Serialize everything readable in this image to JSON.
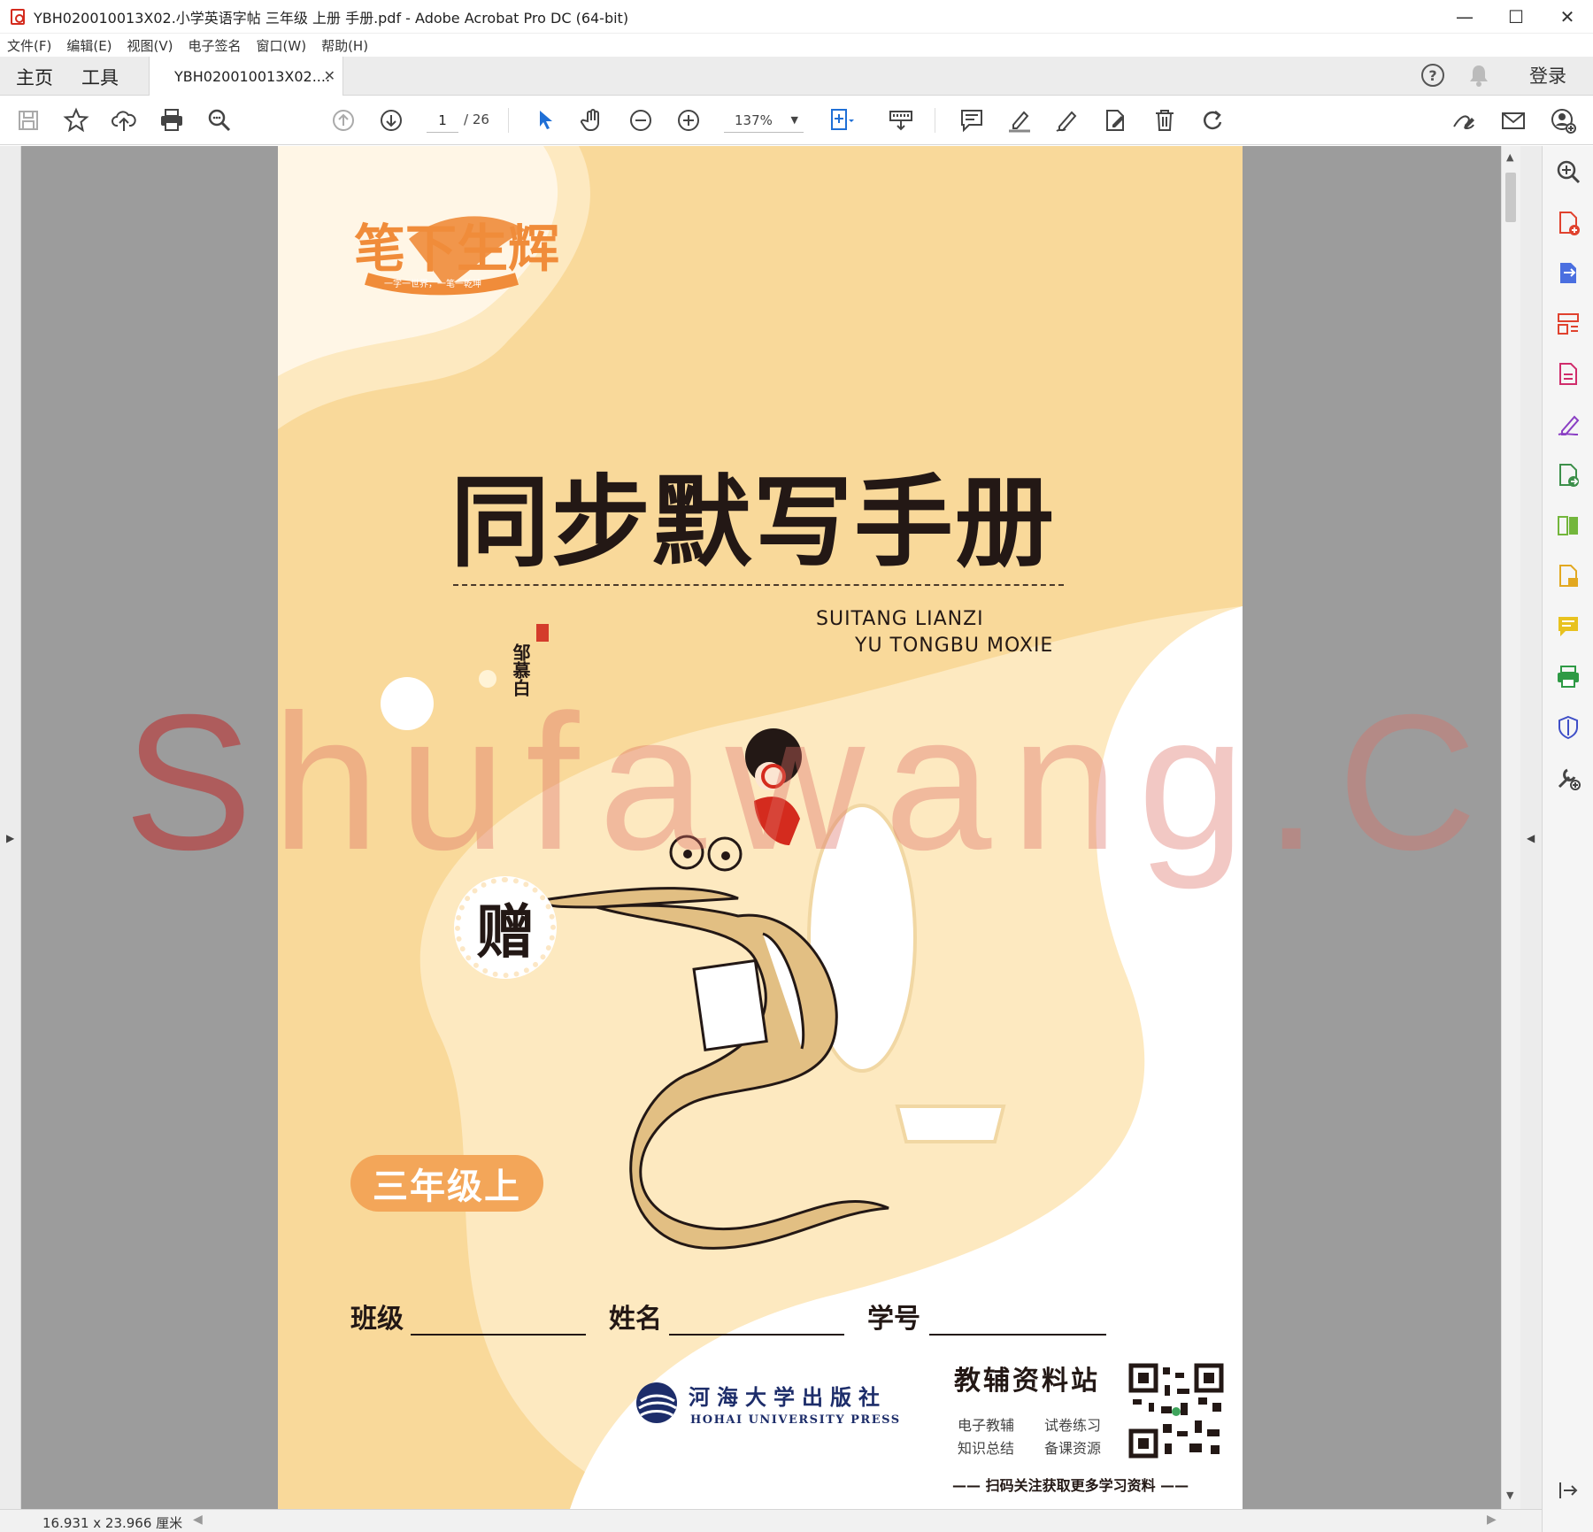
{
  "window": {
    "title": "YBH020010013X02.小学英语字帖 三年级 上册 手册.pdf - Adobe Acrobat Pro DC (64-bit)",
    "minimize": "—",
    "maximize": "☐",
    "close": "✕"
  },
  "menu": [
    "文件(F)",
    "编辑(E)",
    "视图(V)",
    "电子签名",
    "窗口(W)",
    "帮助(H)"
  ],
  "tabs": {
    "home": "主页",
    "tools": "工具",
    "document": "YBH020010013X02....",
    "document_close": "✕",
    "login": "登录"
  },
  "toolbar": {
    "current_page": "1",
    "total_pages": "/ 26",
    "zoom": "137%"
  },
  "status": {
    "page_size": "16.931 x 23.966 厘米"
  },
  "document": {
    "brand_logo": "笔下生辉",
    "brand_slogan": "一字一世界，一笔一乾坤",
    "title": "同步默写手册",
    "pinyin_line1": "SUITANG  LIANZI",
    "pinyin_line2": "YU TONGBU  MOXIE",
    "gift_char": "赠",
    "calligrapher_signature": "邹慕白",
    "grade": "三年级上",
    "fields": {
      "class": "班级",
      "name": "姓名",
      "student_id": "学号"
    },
    "publisher_cn": "河海大学出版社",
    "publisher_en": "HOHAI UNIVERSITY PRESS",
    "site_title": "教辅资料站",
    "site_tags": [
      "电子教辅",
      "试卷练习",
      "知识总结",
      "备课资源"
    ],
    "scan_text": "—— 扫码关注获取更多学习资料 ——"
  },
  "watermark": {
    "first": "S",
    "rest": "hufawang.CN"
  },
  "colors": {
    "page_bg": "#f9d99a",
    "grade_badge": "#f3a659",
    "accent_blue": "#1f6fd6",
    "viewer_bg": "#9c9c9c"
  }
}
